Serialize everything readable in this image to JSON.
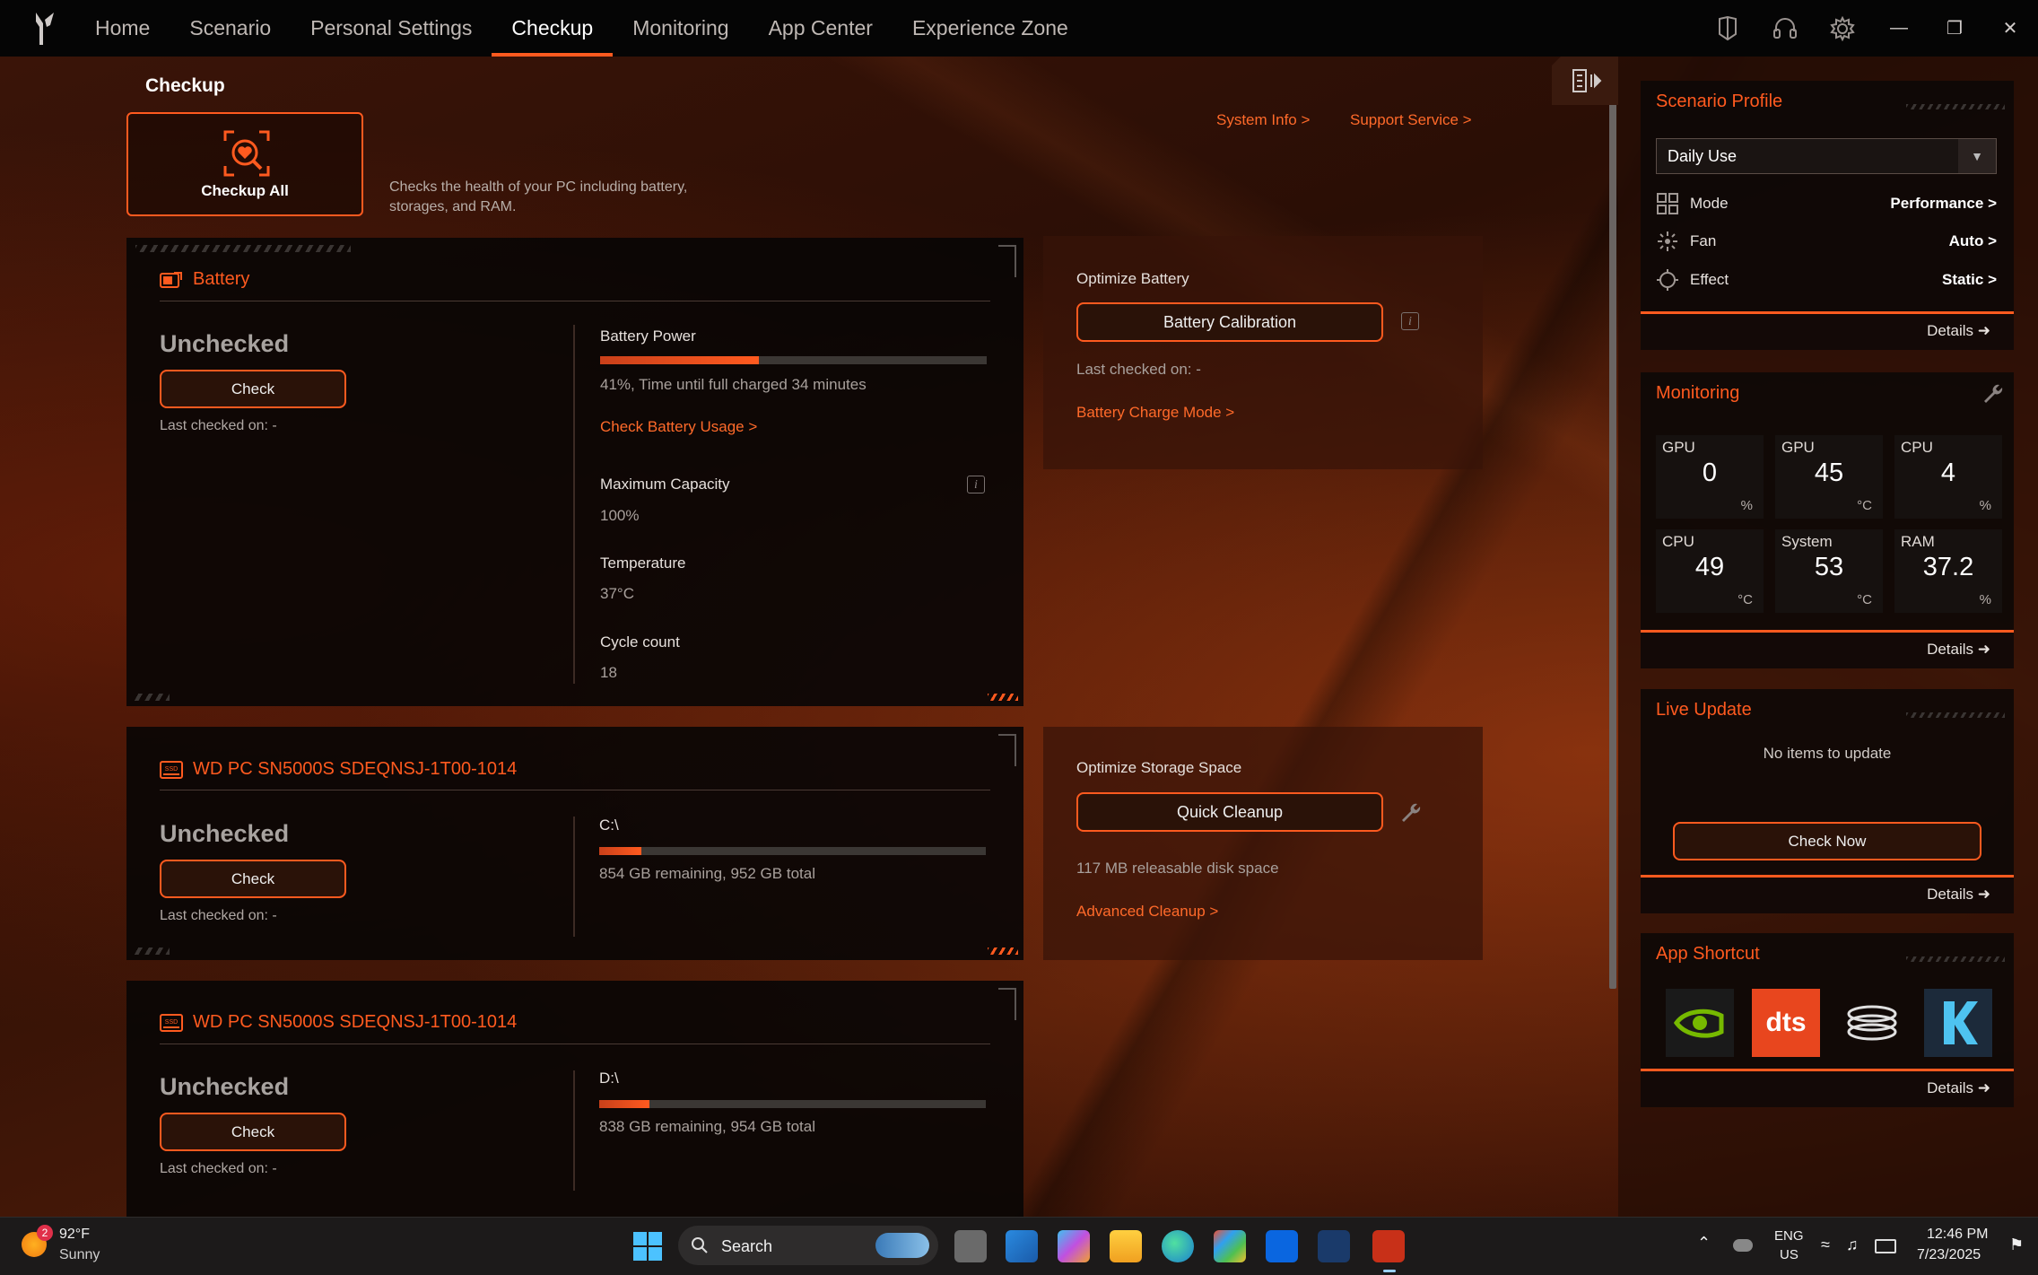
{
  "nav": {
    "items": [
      "Home",
      "Scenario",
      "Personal Settings",
      "Checkup",
      "Monitoring",
      "App Center",
      "Experience Zone"
    ],
    "active": "Checkup"
  },
  "page": {
    "title": "Checkup",
    "checkup_all_label": "Checkup All",
    "checkup_desc": "Checks the health of your PC including battery, storages, and RAM.",
    "system_info": "System Info >",
    "support_service": "Support Service >"
  },
  "battery": {
    "title": "Battery",
    "status": "Unchecked",
    "check_label": "Check",
    "last_checked": "Last checked on: -",
    "power_label": "Battery Power",
    "power_percent": 41,
    "power_text": "41%, Time until full charged 34 minutes",
    "usage_link": "Check Battery Usage >",
    "max_capacity_label": "Maximum Capacity",
    "max_capacity": "100%",
    "temperature_label": "Temperature",
    "temperature": "37°C",
    "cycle_label": "Cycle count",
    "cycle": "18"
  },
  "optimize_battery": {
    "title": "Optimize Battery",
    "button": "Battery Calibration",
    "last_checked": "Last checked on: -",
    "link": "Battery Charge Mode >"
  },
  "drives": [
    {
      "title": "WD PC SN5000S SDEQNSJ-1T00-1014",
      "status": "Unchecked",
      "check_label": "Check",
      "last_checked": "Last checked on: -",
      "drive": "C:\\",
      "used_fraction": 0.11,
      "space_text": "854 GB remaining, 952 GB total"
    },
    {
      "title": "WD PC SN5000S SDEQNSJ-1T00-1014",
      "status": "Unchecked",
      "check_label": "Check",
      "last_checked": "Last checked on: -",
      "drive": "D:\\",
      "used_fraction": 0.13,
      "space_text": "838 GB remaining, 954 GB total"
    }
  ],
  "optimize_storage": {
    "title": "Optimize Storage Space",
    "button": "Quick Cleanup",
    "releasable": "117 MB releasable disk space",
    "link": "Advanced Cleanup >"
  },
  "scenario_profile": {
    "title": "Scenario Profile",
    "selected": "Daily Use",
    "rows": [
      {
        "key": "Mode",
        "value": "Performance >",
        "icon": "grid-icon"
      },
      {
        "key": "Fan",
        "value": "Auto >",
        "icon": "fan-icon"
      },
      {
        "key": "Effect",
        "value": "Static >",
        "icon": "effect-icon"
      }
    ],
    "details": "Details"
  },
  "monitoring": {
    "title": "Monitoring",
    "tiles": [
      {
        "label": "GPU",
        "value": "0",
        "unit": "%"
      },
      {
        "label": "GPU",
        "value": "45",
        "unit": "°C"
      },
      {
        "label": "CPU",
        "value": "4",
        "unit": "%"
      },
      {
        "label": "CPU",
        "value": "49",
        "unit": "°C"
      },
      {
        "label": "System",
        "value": "53",
        "unit": "°C"
      },
      {
        "label": "RAM",
        "value": "37.2",
        "unit": "%"
      }
    ],
    "details": "Details"
  },
  "live_update": {
    "title": "Live Update",
    "message": "No items to update",
    "button": "Check Now",
    "details": "Details"
  },
  "app_shortcut": {
    "title": "App Shortcut",
    "apps": [
      "nvidia-icon",
      "dts-icon",
      "spiral-app-icon",
      "killer-icon"
    ],
    "dts_label": "dts",
    "details": "Details"
  },
  "taskbar": {
    "weather_temp": "92°F",
    "weather_text": "Sunny",
    "weather_badge": "2",
    "search": "Search",
    "lang1": "ENG",
    "lang2": "US",
    "time": "12:46 PM",
    "date": "7/23/2025"
  },
  "colors": {
    "accent": "#ff5a1f",
    "background": "#2a0e05"
  }
}
